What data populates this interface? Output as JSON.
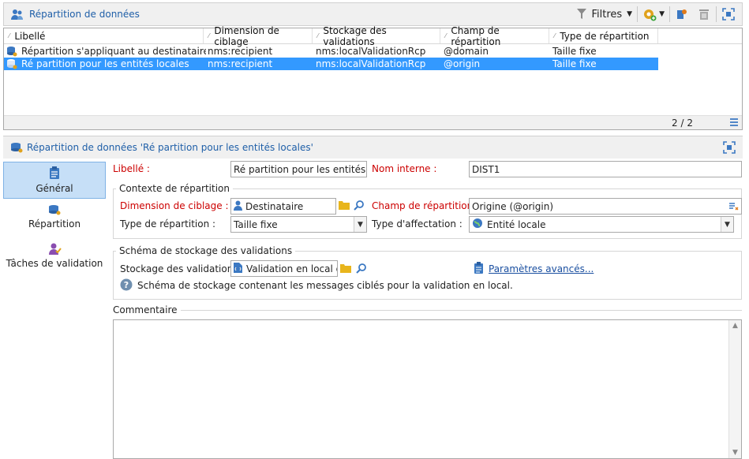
{
  "top_panel": {
    "title": "Répartition de données",
    "filters_label": "Filtres"
  },
  "grid": {
    "columns": [
      "Libellé",
      "Dimension de ciblage",
      "Stockage des validations",
      "Champ de répartition",
      "Type de répartition"
    ],
    "rows": [
      {
        "label": "Répartition s'appliquant au destinataires",
        "dimension": "nms:recipient",
        "storage": "nms:localValidationRcp",
        "field": "@domain",
        "type": "Taille fixe"
      },
      {
        "label": "Ré partition pour les entités locales",
        "dimension": "nms:recipient",
        "storage": "nms:localValidationRcp",
        "field": "@origin",
        "type": "Taille fixe"
      }
    ],
    "pagination": "2 / 2"
  },
  "detail": {
    "title": "Répartition de données 'Ré partition pour les entités locales'"
  },
  "nav": {
    "items": [
      {
        "label": "Général"
      },
      {
        "label": "Répartition"
      },
      {
        "label": "Tâches de validation"
      }
    ]
  },
  "form": {
    "libelle_label": "Libellé :",
    "libelle_value": "Ré partition pour les entités locales",
    "nom_interne_label": "Nom interne :",
    "nom_interne_value": "DIST1",
    "context_group_title": "Contexte de répartition",
    "dimension_label": "Dimension de ciblage :",
    "dimension_value": "Destinataire",
    "champ_label": "Champ de répartition :",
    "champ_value": "Origine (@origin)",
    "type_rep_label": "Type de répartition :",
    "type_rep_value": "Taille fixe",
    "type_aff_label": "Type d'affectation :",
    "type_aff_value": "Entité locale",
    "schema_group_title": "Schéma de stockage des validations",
    "stockage_label": "Stockage des validations :",
    "stockage_value": "Validation en local d'u",
    "advanced_link": "Paramètres avancés...",
    "schema_help": "Schéma de stockage contenant les messages ciblés pour la validation en local.",
    "comment_title": "Commentaire"
  },
  "colors": {
    "accent": "#1f5fa8",
    "selected_row": "#3399ff",
    "required": "#cc0000",
    "nav_active": "#c6dff7"
  }
}
